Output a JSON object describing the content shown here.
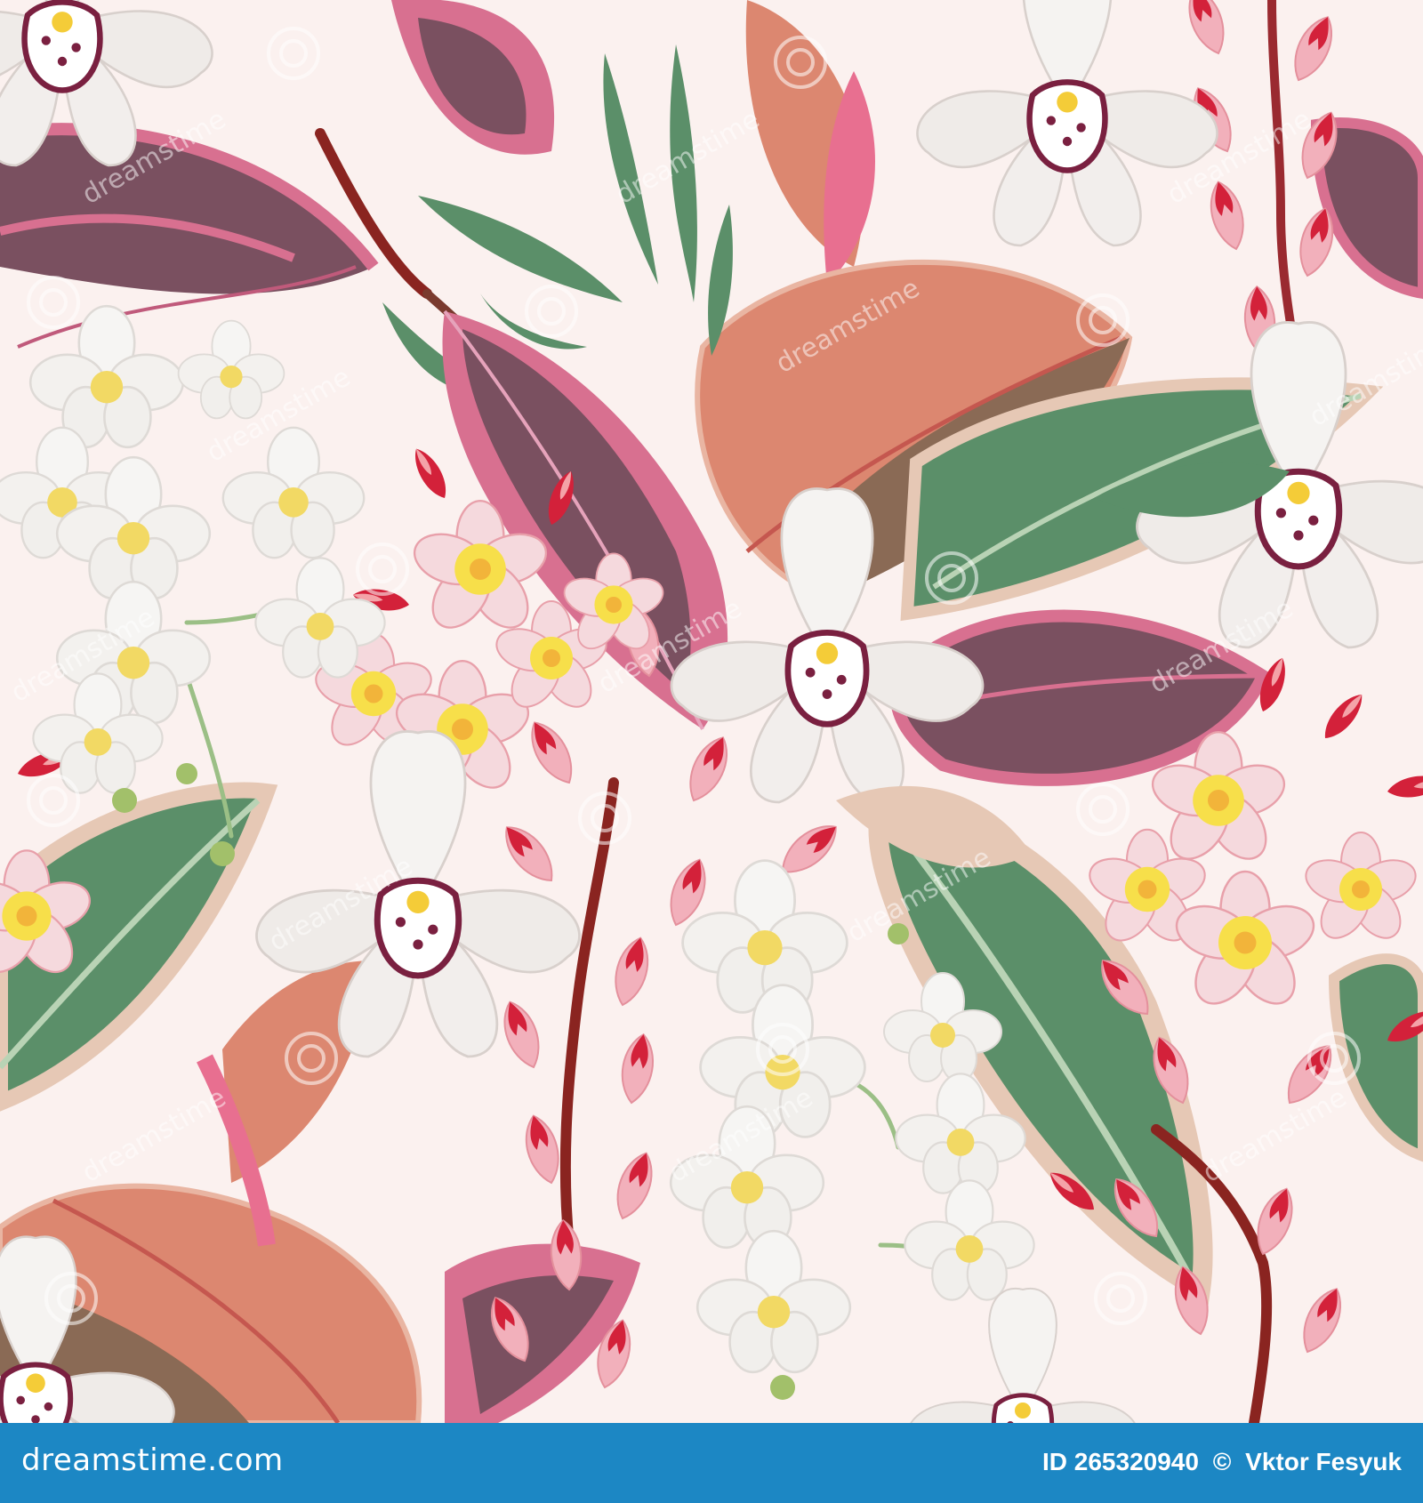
{
  "image": {
    "subject": "seamless tropical floral pattern",
    "background_color": "#fbf1ef"
  },
  "watermark": {
    "text": "dreamstime"
  },
  "footer": {
    "site": "dreamstime.com",
    "id_label": "ID 265320940",
    "separator": "©",
    "author": "Vktor Fesyuk",
    "background_color": "#1c87c4",
    "text_color": "#ffffff"
  },
  "palette": {
    "rubber_leaf_dark": "#7a5060",
    "rubber_leaf_pink": "#d87090",
    "salmon_leaf": "#dc8770",
    "green_leaf": "#5b8f69",
    "pale_green": "#b9d3b5",
    "beige": "#e6c8b5",
    "orchid_white": "#f4f1ef",
    "orchid_lip": "#7a2040",
    "plumeria_yellow": "#f7df4a",
    "pink_bud": "#f2b0bb",
    "red_bud": "#d3213a",
    "stem": "#8a2420"
  }
}
